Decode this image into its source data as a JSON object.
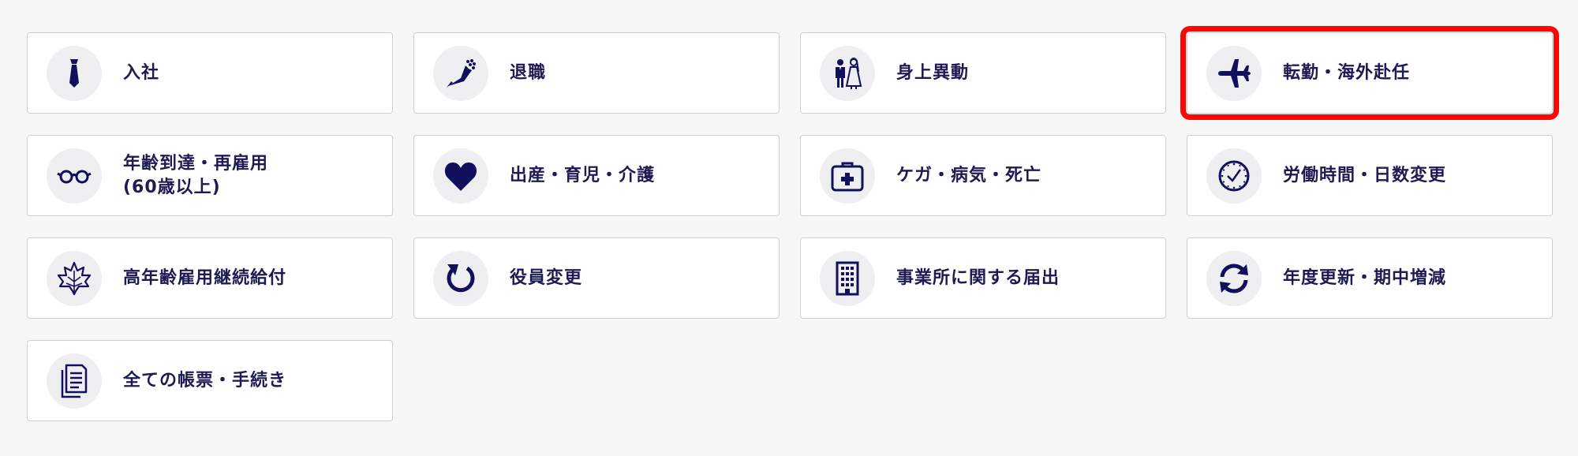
{
  "colors": {
    "text": "#1e1a52",
    "icon": "#12105c",
    "icon_bg": "#efeff2",
    "card_border": "#cfcfcf",
    "highlight": "#f50a0a",
    "page_bg": "#f7f7f7"
  },
  "cards": [
    {
      "label": "入社",
      "icon": "necktie-icon"
    },
    {
      "label": "退職",
      "icon": "bouquet-icon"
    },
    {
      "label": "身上異動",
      "icon": "wedding-couple-icon"
    },
    {
      "label": "転勤・海外赴任",
      "icon": "airplane-icon",
      "selected": true
    },
    {
      "label": "年齢到達・再雇用",
      "label2": "(60歳以上)",
      "icon": "glasses-icon"
    },
    {
      "label": "出産・育児・介護",
      "icon": "heart-icon"
    },
    {
      "label": "ケガ・病気・死亡",
      "icon": "medical-kit-icon"
    },
    {
      "label": "労働時間・日数変更",
      "icon": "clock-icon"
    },
    {
      "label": "高年齢雇用継続給付",
      "icon": "maple-leaf-icon"
    },
    {
      "label": "役員変更",
      "icon": "rotate-arrow-icon"
    },
    {
      "label": "事業所に関する届出",
      "icon": "building-icon"
    },
    {
      "label": "年度更新・期中増減",
      "icon": "refresh-icon"
    },
    {
      "label": "全ての帳票・手続き",
      "icon": "documents-icon"
    }
  ]
}
